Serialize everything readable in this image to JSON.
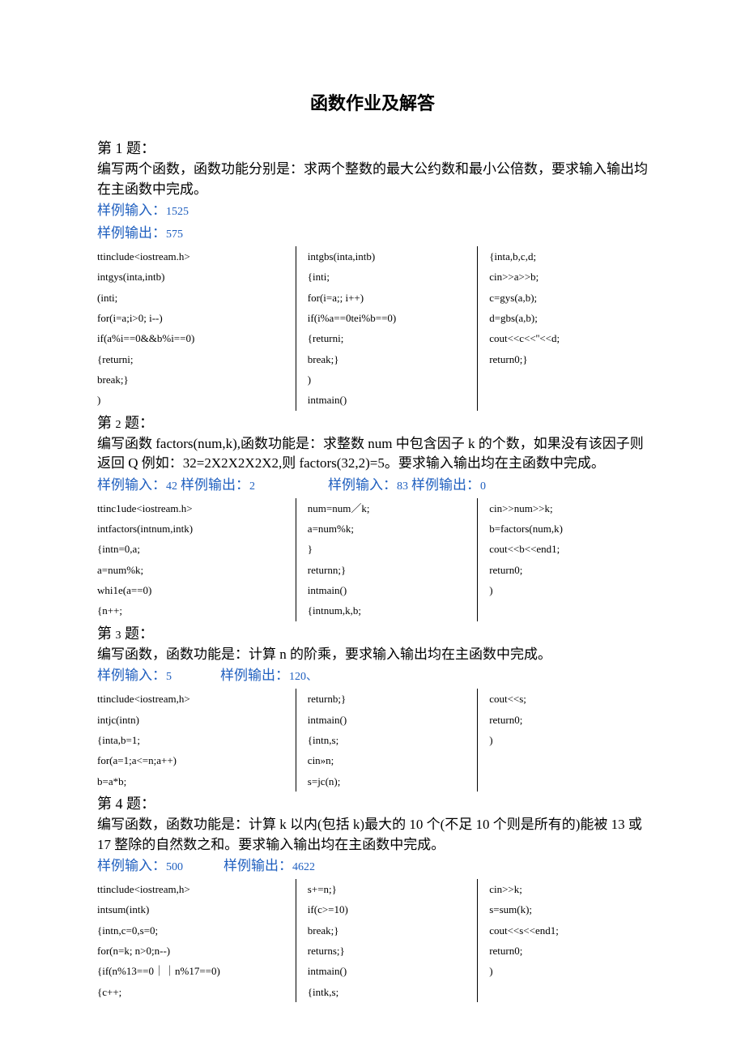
{
  "title": "函数作业及解答",
  "q1": {
    "heading_prefix": "第 1 题：",
    "desc": "编写两个函数，函数功能分别是：求两个整数的最大公约数和最小公倍数，要求输入输出均在主函数中完成。",
    "sample_in_label": "样例输入：",
    "sample_in_val": "1525",
    "sample_out_label": "样例输出：",
    "sample_out_val": "575",
    "col1": [
      "ttinclude<iostream.h>",
      "intgys(inta,intb)",
      "(inti;",
      "for(i=a;i>0; i--)",
      "if(a%i==0&&b%i==0)",
      "{returni;",
      "break;}",
      ")"
    ],
    "col2": [
      "intgbs(inta,intb)",
      "{inti;",
      "for(i=a;; i++)",
      "if(i%a==0tei%b==0)",
      "{returni;",
      "break;}",
      ")",
      "intmain()"
    ],
    "col3": [
      "{inta,b,c,d;",
      "cin>>a>>b;",
      "c=gys(a,b);",
      "d=gbs(a,b);",
      "cout<<c<<''<<d;",
      "return0;}"
    ]
  },
  "q2": {
    "heading_prefix": "第 ",
    "heading_num": "2",
    "heading_suffix": " 题：",
    "desc": "编写函数 factors(num,k),函数功能是：求整数 num 中包含因子 k 的个数，如果没有该因子则返回 Q 例如：32=2X2X2X2X2,则 factors(32,2)=5。要求输入输出均在主函数中完成。",
    "sample_line": {
      "in1_label": "样例输入：",
      "in1_val": "42",
      "out1_label": "样例输出：",
      "out1_val": "2",
      "in2_label": "样例输入：",
      "in2_val": "83",
      "out2_label": "样例输出：",
      "out2_val": "0"
    },
    "col1": [
      "ttinc1ude<iostream.h>",
      "intfactors(intnum,intk)",
      "{intn=0,a;",
      "a=num%k;",
      "whi1e(a==0)",
      "{n++;"
    ],
    "col2": [
      "num=num／k;",
      "a=num%k;",
      "}",
      "returnn;}",
      "intmain()",
      "{intnum,k,b;"
    ],
    "col3": [
      "cin>>num>>k;",
      "b=factors(num,k)",
      "cout<<b<<end1;",
      "return0;",
      ")"
    ]
  },
  "q3": {
    "heading_prefix": "第 ",
    "heading_num": "3",
    "heading_suffix": " 题：",
    "desc": "编写函数，函数功能是：计算 n 的阶乘，要求输入输出均在主函数中完成。",
    "sample_in_label": "样例输入：",
    "sample_in_val": "5",
    "sample_out_label": "样例输出：",
    "sample_out_val": "120、",
    "col1": [
      "ttinclude<iostream,h>",
      "intjc(intn)",
      "{inta,b=1;",
      "for(a=1;a<=n;a++)",
      "b=a*b;"
    ],
    "col2": [
      "returnb;}",
      "intmain()",
      "{intn,s;",
      "cin»n;",
      "s=jc(n);"
    ],
    "col3": [
      "cout<<s;",
      "return0;",
      ")"
    ]
  },
  "q4": {
    "heading_prefix": "第 4 题：",
    "desc": "编写函数，函数功能是：计算 k 以内(包括 k)最大的 10 个(不足 10 个则是所有的)能被 13 或 17 整除的自然数之和。要求输入输出均在主函数中完成。",
    "sample_in_label": "样例输入：",
    "sample_in_val": "500",
    "sample_out_label": "样例输出：",
    "sample_out_val": "4622",
    "col1": [
      "ttinclude<iostream,h>",
      "intsum(intk)",
      "{intn,c=0,s=0;",
      "for(n=k; n>0;n--)",
      "{if(n%13==0｜｜n%17==0)",
      "{c++;"
    ],
    "col2": [
      "s+=n;}",
      "if(c>=10)",
      "break;}",
      "returns;}",
      "intmain()",
      "{intk,s;"
    ],
    "col3": [
      "cin>>k;",
      "s=sum(k);",
      "cout<<s<<end1;",
      "return0;",
      ")"
    ]
  }
}
